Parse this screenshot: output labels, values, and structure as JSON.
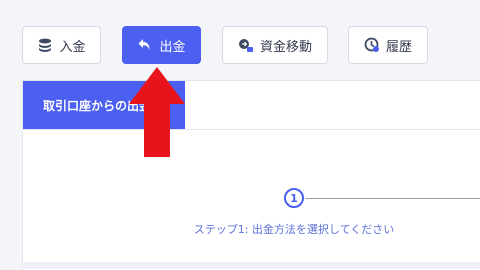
{
  "toolbar": {
    "deposit": {
      "label": "入金",
      "icon": "coins-icon"
    },
    "withdraw": {
      "label": "出金",
      "icon": "undo-arrow-icon"
    },
    "transfer": {
      "label": "資金移動",
      "icon": "transfer-icon"
    },
    "history": {
      "label": "履歴",
      "icon": "clock-history-icon"
    }
  },
  "panel": {
    "tab_label": "取引口座からの出金"
  },
  "stepper": {
    "step_number": "1",
    "step_label": "ステップ1: 出金方法を選択してください"
  },
  "colors": {
    "accent": "#4b5ff0",
    "annotation_arrow": "#e8141c"
  }
}
